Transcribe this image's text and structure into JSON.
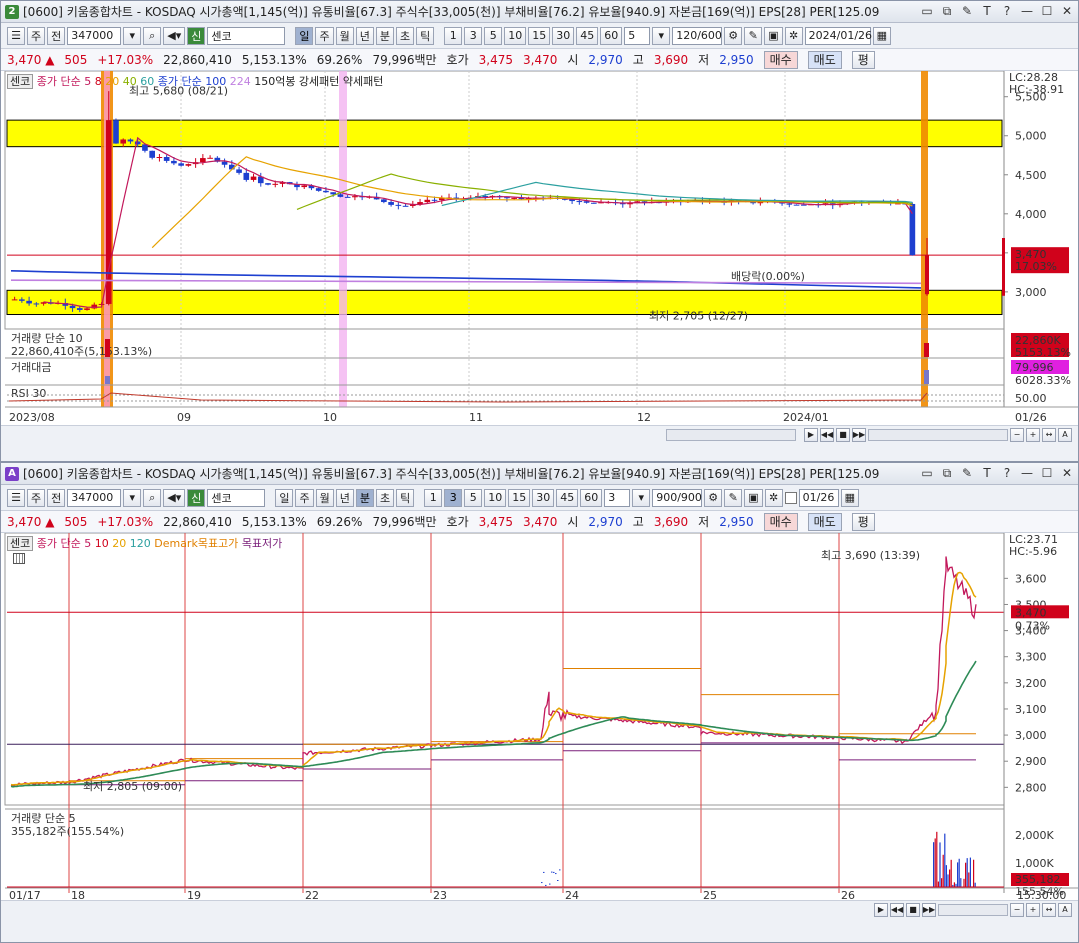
{
  "colors": {
    "up": "#d0021b",
    "down": "#1d3fd0",
    "ma5": "#c2185b",
    "ma20": "#e6a200",
    "ma60": "#2ca0a0",
    "ma120": "#1d3fd0",
    "highlight": "#ffff00",
    "marker": "#f08a00"
  },
  "top": {
    "win_num": "2",
    "title": "[0600] 키움종합차트 - KOSDAQ 시가총액[1,145(억)] 유통비율[67.3] 주식수[33,005(천)] 부채비율[76.2] 유보율[940.9] 자본금[169(억)] EPS[28] PER[125.09",
    "toolbar": {
      "type": "주",
      "mode": "전",
      "code": "347000",
      "badge": "신",
      "name": "센코",
      "periods": [
        "일",
        "주",
        "월",
        "년",
        "분",
        "초",
        "틱"
      ],
      "nums": [
        "1",
        "3",
        "5",
        "10",
        "15",
        "30",
        "45",
        "60"
      ],
      "sel": "5",
      "count": "120/600",
      "date": "2024/01/26"
    },
    "quote": {
      "price": "3,470",
      "arrow": "▲",
      "change": "505",
      "rate": "+17.03%",
      "volume": "22,860,410",
      "vol_ratio": "5,153.13%",
      "x": "69.26%",
      "amount": "79,996백만",
      "hoga_label": "호가",
      "hoga1": "3,475",
      "hoga2": "3,470",
      "open_label": "시",
      "open": "2,970",
      "high_label": "고",
      "high": "3,690",
      "low_label": "저",
      "low": "2,950",
      "buy": "매수",
      "sell": "매도",
      "flat": "평"
    },
    "legend": {
      "name": "센코",
      "l1": "종가 단순 5",
      "l2": "8",
      "l3": "20",
      "l4": "40",
      "l5": "60",
      "l6": "종가 단순 100",
      "l7": "224",
      "l8": "150억봉 강세패턴",
      "l9": "약세패턴"
    },
    "lc": "LC:28.28",
    "hc": "HC:-38.91",
    "y_ticks": [
      "5,500",
      "5,000",
      "4,500",
      "4,000",
      "3,500",
      "3,000"
    ],
    "cur_price": "3,470",
    "cur_rate": "17.03%",
    "max_label": "최고 5,680 (08/21)",
    "min_label": "최저 2,705 (12/27)",
    "div_label": "배당락(0.00%)",
    "vol_legend": "거래량 단순 10",
    "vol_value": "22,860,410주(5,153.13%)",
    "vol_box": "22,860K",
    "vol_box_rate": "5153.13%",
    "amt_legend": "거래대금",
    "amt_box": "79,996",
    "amt_box_rate": "6028.33%",
    "rsi_legend": "RSI 30",
    "rsi_tick": "50.00",
    "dates": [
      "2023/08",
      "09",
      "10",
      "11",
      "12",
      "2024/01",
      "01/26"
    ]
  },
  "bottom": {
    "win_num": "A",
    "title": "[0600] 키움종합차트 - KOSDAQ 시가총액[1,145(억)] 유통비율[67.3] 주식수[33,005(천)] 부채비율[76.2] 유보율[940.9] 자본금[169(억)] EPS[28] PER[125.09",
    "toolbar": {
      "type": "주",
      "mode": "전",
      "code": "347000",
      "badge": "신",
      "name": "센코",
      "periods": [
        "일",
        "주",
        "월",
        "년",
        "분",
        "초",
        "틱"
      ],
      "nums": [
        "1",
        "3",
        "5",
        "10",
        "15",
        "30",
        "45",
        "60"
      ],
      "sel": "3",
      "count": "900/900",
      "date": "01/26"
    },
    "legend": {
      "name": "센코",
      "l1": "종가 단순 5",
      "l2": "10",
      "l3": "20",
      "l4": "120",
      "l5": "Demark목표고가",
      "l6": "목표저가"
    },
    "lc": "LC:23.71",
    "hc": "HC:-5.96",
    "y_ticks": [
      "3,600",
      "3,500",
      "3,400",
      "3,300",
      "3,200",
      "3,100",
      "3,000",
      "2,900",
      "2,800"
    ],
    "cur_price": "3,470",
    "cur_rate": "0.73%",
    "max_label": "최고 3,690 (13:39)",
    "min_label": "최저 2,805 (09:00)",
    "vol_legend": "거래량 단순 5",
    "vol_value": "355,182주(155.54%)",
    "vol_ticks": [
      "2,000K",
      "1,000K"
    ],
    "vol_box": "355,182",
    "vol_box_rate": "155.54%",
    "dates": [
      "01/17",
      "18",
      "19",
      "22",
      "23",
      "24",
      "25",
      "26",
      "15:30:00"
    ]
  }
}
